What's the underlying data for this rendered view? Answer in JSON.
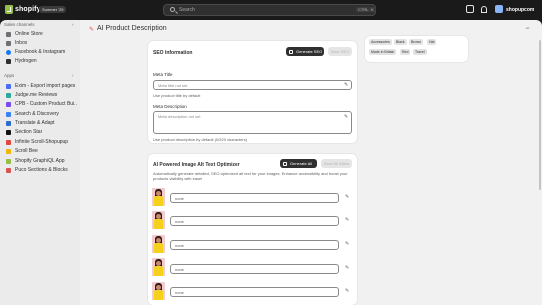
{
  "topbar": {
    "brand": "shopify",
    "edition_badge": "Summer '25",
    "search_placeholder": "Search",
    "shortcut_ctrl": "CTRL",
    "shortcut_k": "K",
    "store_name": "shopupcom"
  },
  "sidebar": {
    "sales_channels_heading": "Sales channels",
    "sales_channels": [
      {
        "label": "Online Store",
        "icon": "store-icon",
        "color": "#6d7175"
      },
      {
        "label": "Inbox",
        "icon": "inbox-icon",
        "color": "#6d7175"
      },
      {
        "label": "Facebook & Instagram",
        "icon": "meta-icon",
        "color": "#1877f2"
      },
      {
        "label": "Hydrogen",
        "icon": "hydrogen-icon",
        "color": "#303030"
      }
    ],
    "apps_heading": "Apps",
    "apps": [
      {
        "label": "Exim - Export import pages",
        "icon": "exim-icon",
        "color": "#4a6cf7"
      },
      {
        "label": "Judge.me Reviews",
        "icon": "judgeme-icon",
        "color": "#2aa99d"
      },
      {
        "label": "CPB - Custom Product Bui...",
        "icon": "cpb-icon",
        "color": "#7a4cf0"
      },
      {
        "label": "Search & Discovery",
        "icon": "search-discovery-icon",
        "color": "#3b82f6"
      },
      {
        "label": "Translate & Adapt",
        "icon": "translate-icon",
        "color": "#2c6ecb"
      },
      {
        "label": "Section Star",
        "icon": "section-star-icon",
        "color": "#111111"
      },
      {
        "label": "Infinite Scroll-Shopupup",
        "icon": "infinite-scroll-icon",
        "color": "#e0483e"
      },
      {
        "label": "Scroll Bee",
        "icon": "scroll-bee-icon",
        "color": "#f2b705"
      },
      {
        "label": "Shopify GraphiQL App",
        "icon": "graphiql-icon",
        "color": "#95bf47"
      },
      {
        "label": "Puco Sections & Blocks",
        "icon": "puco-icon",
        "color": "#d9534f"
      }
    ]
  },
  "main": {
    "page_title": "AI Product Description",
    "seo": {
      "title": "SEO Information",
      "generate_label": "Generate SEO",
      "save_label": "Save SEO",
      "meta_title_label": "Meta Title",
      "meta_title_placeholder": "Meta title not set",
      "meta_title_help": "Use product title by default",
      "meta_desc_label": "Meta Description",
      "meta_desc_placeholder": "Meta description not set",
      "meta_desc_help": "Use product description by default (0/320 characters)"
    },
    "tags": [
      "Accessories",
      "Black",
      "Brown",
      "Hat",
      "Made in Britain",
      "Red",
      "Travel"
    ],
    "alt_text": {
      "title": "AI Powered Image Alt Text Optimizer",
      "generate_all_label": "Generate All",
      "save_all_label": "Save All Alters",
      "description": "Automatically generate detailed, SEO-optimized alt text for your images. Enhance accessibility and boost your products visibility with ease!",
      "rows": [
        {
          "value": "none"
        },
        {
          "value": "none"
        },
        {
          "value": "none"
        },
        {
          "value": "none"
        },
        {
          "value": "none"
        }
      ]
    }
  }
}
